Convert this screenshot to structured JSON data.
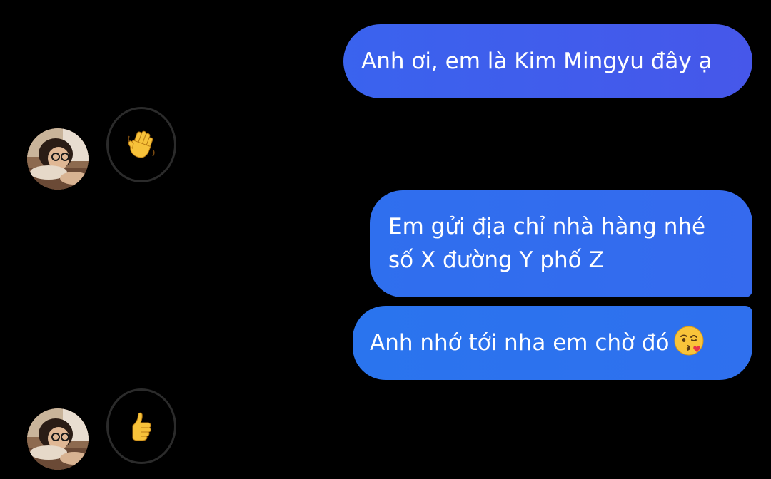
{
  "conversation": {
    "messages": [
      {
        "sender": "me",
        "text": "Anh ơi, em là Kim Mingyu đây ạ"
      },
      {
        "sender": "other",
        "reaction_icon": "waving-hand-icon"
      },
      {
        "sender": "me",
        "line1": "Em gửi địa chỉ nhà hàng nhé",
        "line2": "số X đường Y phố Z"
      },
      {
        "sender": "me",
        "text": "Anh nhớ tới nha em chờ đó",
        "emoji_icon": "kissing-face-icon"
      },
      {
        "sender": "other",
        "reaction_icon": "thumbs-up-icon"
      }
    ]
  },
  "colors": {
    "background": "#000000",
    "sent_bubble": "#356aee",
    "reaction_ring": "#2b2b2b"
  }
}
